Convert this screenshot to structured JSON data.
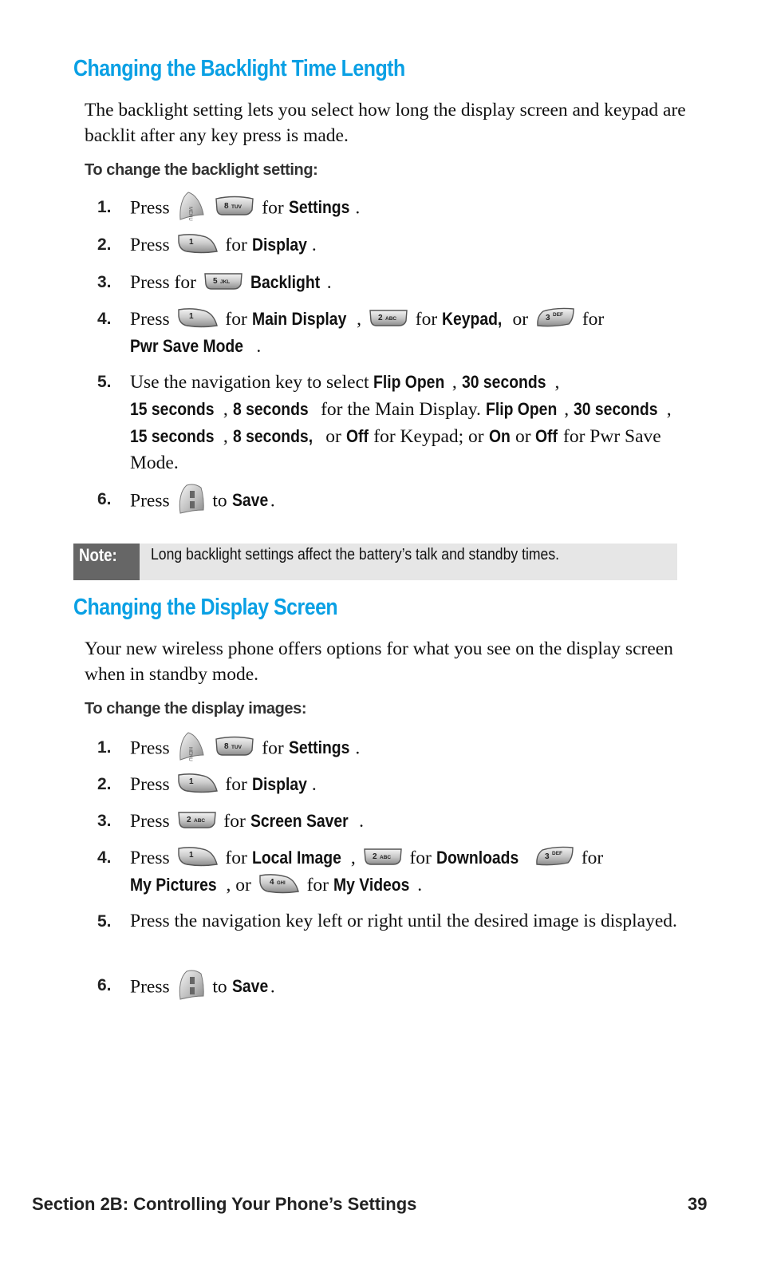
{
  "sections": [
    {
      "title": "Changing the Backlight Time Length",
      "intro": "The backlight setting lets you select how long the display screen and keypad are backlit after any key press is made.",
      "subheading": "To change the backlight setting:",
      "steps": [
        {
          "num": "1.",
          "t1": "Press",
          "t2": "for",
          "b1": "Settings",
          "t3": "."
        },
        {
          "num": "2.",
          "t1": "Press",
          "t2": "for",
          "b1": "Display",
          "t3": "."
        },
        {
          "num": "3.",
          "t1": "Press for",
          "b1": "Backlight",
          "t3": "."
        },
        {
          "num": "4.",
          "t1": "Press",
          "t2": "for",
          "b1": "Main Display",
          "t3": ",",
          "t4": "for",
          "b2": "Keypad,",
          "t5": "or",
          "t6": "for",
          "b3": "Pwr Save Mode",
          "t7": "."
        },
        {
          "num": "5.",
          "t1": "Use the navigation key to select",
          "b1": "Flip Open",
          "c1": ",",
          "b2": "30 seconds",
          "c2": ",",
          "b3": "15 seconds",
          "c3": ",",
          "b4": "8 seconds",
          "t2": "for the Main Display.",
          "b5": "Flip Open",
          "c4": ",",
          "b6": "30 seconds",
          "c5": ",",
          "b7": "15 seconds",
          "c6": ",",
          "b8": "8 seconds,",
          "t3": "or",
          "b9": "Off",
          "t4": "for Keypad; or",
          "b10": "On",
          "t5": "or",
          "b11": "Off",
          "t6": "for Pwr Save Mode."
        },
        {
          "num": "6.",
          "t1": "Press",
          "t2": "to",
          "b1": "Save",
          "t3": "."
        }
      ]
    },
    {
      "title": "Changing the Display Screen",
      "intro": "Your new wireless phone offers options for what you see on the display screen when in standby mode.",
      "subheading": "To change the display images:",
      "steps": [
        {
          "num": "1.",
          "t1": "Press",
          "t2": "for",
          "b1": "Settings",
          "t3": "."
        },
        {
          "num": "2.",
          "t1": "Press",
          "t2": "for",
          "b1": "Display",
          "t3": "."
        },
        {
          "num": "3.",
          "t1": "Press",
          "t2": "for",
          "b1": "Screen Saver",
          "t3": "."
        },
        {
          "num": "4.",
          "t1": "Press",
          "t2": "for",
          "b1": "Local Image",
          "c1": ",",
          "t3": "for",
          "b2": "Downloads",
          "t4": "for",
          "b3": "My Pictures",
          "t5": ", or",
          "t6": "for",
          "b4": "My Videos",
          "t7": "."
        },
        {
          "num": "5.",
          "t1": "Press the navigation key left or right until the desired image is displayed."
        },
        {
          "num": "6.",
          "t1": "Press",
          "t2": "to",
          "b1": "Save",
          "t3": "."
        }
      ]
    }
  ],
  "note": {
    "label": "Note:",
    "text": "Long backlight settings affect the battery’s talk and standby times."
  },
  "keys": {
    "menu": {
      "icon": "menu-ok-key-icon",
      "label": "MENU"
    },
    "k1": {
      "icon": "key-1-icon",
      "label": "1"
    },
    "k2": {
      "icon": "key-2abc-icon",
      "label": "2",
      "letters": "ABC"
    },
    "k3": {
      "icon": "key-3def-icon",
      "label": "3",
      "letters": "DEF"
    },
    "k4": {
      "icon": "key-4ghi-icon",
      "label": "4",
      "letters": "GHI"
    },
    "k5": {
      "icon": "key-5jkl-icon",
      "label": "5",
      "letters": "JKL"
    },
    "k8": {
      "icon": "key-8tuv-icon",
      "label": "8",
      "letters": "TUV"
    },
    "ok": {
      "icon": "menu-ok-save-key-icon",
      "label": "OK"
    }
  },
  "colors": {
    "heading": "#0aa0e4",
    "note_label_bg": "#666666",
    "note_bg": "#e6e6e6"
  },
  "footer": {
    "section": "Section 2B: Controlling Your Phone’s Settings",
    "page_number": "39"
  }
}
